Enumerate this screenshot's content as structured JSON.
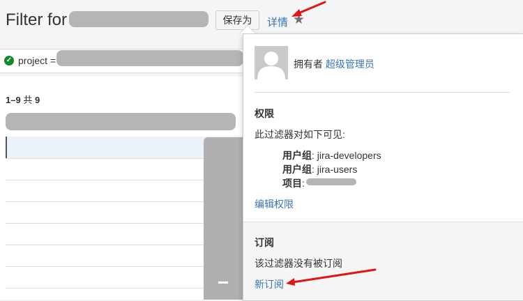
{
  "header": {
    "title": "Filter for",
    "save_as_label": "保存为",
    "details_link": "详情",
    "favorite_icon": "star-icon"
  },
  "filter_bar": {
    "status_icon": "check-circle-icon",
    "query_prefix": "project ="
  },
  "results": {
    "range": "1–9",
    "of_label": "共",
    "total": "9"
  },
  "details_popup": {
    "owner_label": "拥有者",
    "owner_name": "超级管理员",
    "permissions_heading": "权限",
    "visible_to_label": "此过滤器对如下可见:",
    "shares": [
      {
        "type": "用户组",
        "value": ": jira-developers"
      },
      {
        "type": "用户组",
        "value": ": jira-users"
      },
      {
        "type": "项目",
        "value": ":"
      }
    ],
    "edit_permissions_link": "编辑权限",
    "subscriptions_heading": "订阅",
    "no_subscriptions_text": "该过滤器没有被订阅",
    "new_subscription_link": "新订阅"
  },
  "colors": {
    "link": "#3b73af",
    "success": "#14892c",
    "arrow": "#e01616"
  }
}
